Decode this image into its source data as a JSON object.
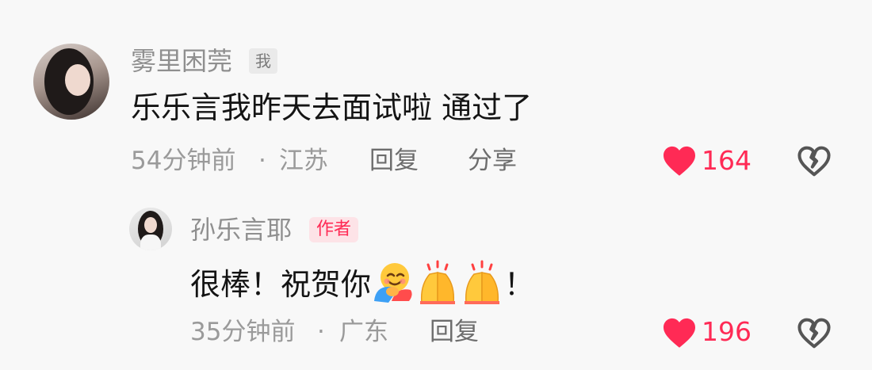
{
  "comment": {
    "username": "雾里困莞",
    "tag": "我",
    "text": "乐乐言我昨天去面试啦 通过了",
    "time": "54分钟前",
    "separator": "·",
    "location": "江苏",
    "reply_label": "回复",
    "share_label": "分享",
    "likes": "164",
    "like_icon": "heart-icon",
    "dislike_icon": "broken-heart-icon"
  },
  "reply": {
    "username": "孙乐言耶",
    "tag": "作者",
    "text": "很棒！祝贺你",
    "emojis": [
      "smiling-face-with-hearts-hug-emoji",
      "clapping-hands-emoji",
      "clapping-hands-emoji"
    ],
    "text_end": "！",
    "time": "35分钟前",
    "separator": "·",
    "location": "广东",
    "reply_label": "回复",
    "likes": "196",
    "like_icon": "heart-icon",
    "dislike_icon": "broken-heart-icon"
  },
  "colors": {
    "like": "#ff2a55",
    "author_tag_bg": "#fde3e7",
    "background": "#f8f8f8"
  }
}
